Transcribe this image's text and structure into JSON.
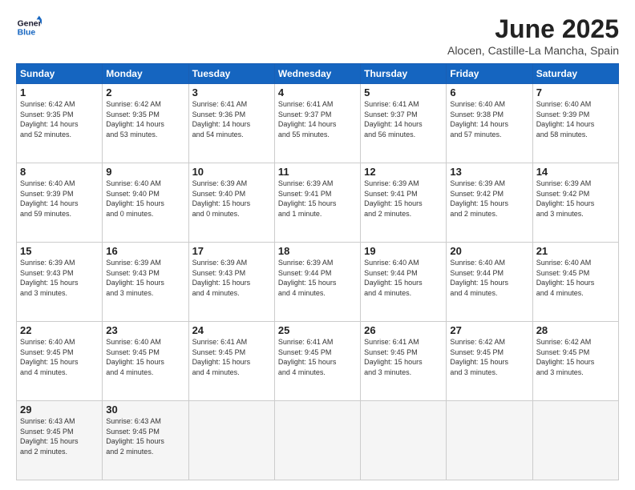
{
  "header": {
    "logo": {
      "line1": "General",
      "line2": "Blue"
    },
    "title": "June 2025",
    "subtitle": "Alocen, Castille-La Mancha, Spain"
  },
  "weekdays": [
    "Sunday",
    "Monday",
    "Tuesday",
    "Wednesday",
    "Thursday",
    "Friday",
    "Saturday"
  ],
  "weeks": [
    [
      {
        "day": "1",
        "text": "Sunrise: 6:42 AM\nSunset: 9:35 PM\nDaylight: 14 hours\nand 52 minutes."
      },
      {
        "day": "2",
        "text": "Sunrise: 6:42 AM\nSunset: 9:35 PM\nDaylight: 14 hours\nand 53 minutes."
      },
      {
        "day": "3",
        "text": "Sunrise: 6:41 AM\nSunset: 9:36 PM\nDaylight: 14 hours\nand 54 minutes."
      },
      {
        "day": "4",
        "text": "Sunrise: 6:41 AM\nSunset: 9:37 PM\nDaylight: 14 hours\nand 55 minutes."
      },
      {
        "day": "5",
        "text": "Sunrise: 6:41 AM\nSunset: 9:37 PM\nDaylight: 14 hours\nand 56 minutes."
      },
      {
        "day": "6",
        "text": "Sunrise: 6:40 AM\nSunset: 9:38 PM\nDaylight: 14 hours\nand 57 minutes."
      },
      {
        "day": "7",
        "text": "Sunrise: 6:40 AM\nSunset: 9:39 PM\nDaylight: 14 hours\nand 58 minutes."
      }
    ],
    [
      {
        "day": "8",
        "text": "Sunrise: 6:40 AM\nSunset: 9:39 PM\nDaylight: 14 hours\nand 59 minutes."
      },
      {
        "day": "9",
        "text": "Sunrise: 6:40 AM\nSunset: 9:40 PM\nDaylight: 15 hours\nand 0 minutes."
      },
      {
        "day": "10",
        "text": "Sunrise: 6:39 AM\nSunset: 9:40 PM\nDaylight: 15 hours\nand 0 minutes."
      },
      {
        "day": "11",
        "text": "Sunrise: 6:39 AM\nSunset: 9:41 PM\nDaylight: 15 hours\nand 1 minute."
      },
      {
        "day": "12",
        "text": "Sunrise: 6:39 AM\nSunset: 9:41 PM\nDaylight: 15 hours\nand 2 minutes."
      },
      {
        "day": "13",
        "text": "Sunrise: 6:39 AM\nSunset: 9:42 PM\nDaylight: 15 hours\nand 2 minutes."
      },
      {
        "day": "14",
        "text": "Sunrise: 6:39 AM\nSunset: 9:42 PM\nDaylight: 15 hours\nand 3 minutes."
      }
    ],
    [
      {
        "day": "15",
        "text": "Sunrise: 6:39 AM\nSunset: 9:43 PM\nDaylight: 15 hours\nand 3 minutes."
      },
      {
        "day": "16",
        "text": "Sunrise: 6:39 AM\nSunset: 9:43 PM\nDaylight: 15 hours\nand 3 minutes."
      },
      {
        "day": "17",
        "text": "Sunrise: 6:39 AM\nSunset: 9:43 PM\nDaylight: 15 hours\nand 4 minutes."
      },
      {
        "day": "18",
        "text": "Sunrise: 6:39 AM\nSunset: 9:44 PM\nDaylight: 15 hours\nand 4 minutes."
      },
      {
        "day": "19",
        "text": "Sunrise: 6:40 AM\nSunset: 9:44 PM\nDaylight: 15 hours\nand 4 minutes."
      },
      {
        "day": "20",
        "text": "Sunrise: 6:40 AM\nSunset: 9:44 PM\nDaylight: 15 hours\nand 4 minutes."
      },
      {
        "day": "21",
        "text": "Sunrise: 6:40 AM\nSunset: 9:45 PM\nDaylight: 15 hours\nand 4 minutes."
      }
    ],
    [
      {
        "day": "22",
        "text": "Sunrise: 6:40 AM\nSunset: 9:45 PM\nDaylight: 15 hours\nand 4 minutes."
      },
      {
        "day": "23",
        "text": "Sunrise: 6:40 AM\nSunset: 9:45 PM\nDaylight: 15 hours\nand 4 minutes."
      },
      {
        "day": "24",
        "text": "Sunrise: 6:41 AM\nSunset: 9:45 PM\nDaylight: 15 hours\nand 4 minutes."
      },
      {
        "day": "25",
        "text": "Sunrise: 6:41 AM\nSunset: 9:45 PM\nDaylight: 15 hours\nand 4 minutes."
      },
      {
        "day": "26",
        "text": "Sunrise: 6:41 AM\nSunset: 9:45 PM\nDaylight: 15 hours\nand 3 minutes."
      },
      {
        "day": "27",
        "text": "Sunrise: 6:42 AM\nSunset: 9:45 PM\nDaylight: 15 hours\nand 3 minutes."
      },
      {
        "day": "28",
        "text": "Sunrise: 6:42 AM\nSunset: 9:45 PM\nDaylight: 15 hours\nand 3 minutes."
      }
    ],
    [
      {
        "day": "29",
        "text": "Sunrise: 6:43 AM\nSunset: 9:45 PM\nDaylight: 15 hours\nand 2 minutes."
      },
      {
        "day": "30",
        "text": "Sunrise: 6:43 AM\nSunset: 9:45 PM\nDaylight: 15 hours\nand 2 minutes."
      },
      {
        "day": "",
        "text": ""
      },
      {
        "day": "",
        "text": ""
      },
      {
        "day": "",
        "text": ""
      },
      {
        "day": "",
        "text": ""
      },
      {
        "day": "",
        "text": ""
      }
    ]
  ]
}
